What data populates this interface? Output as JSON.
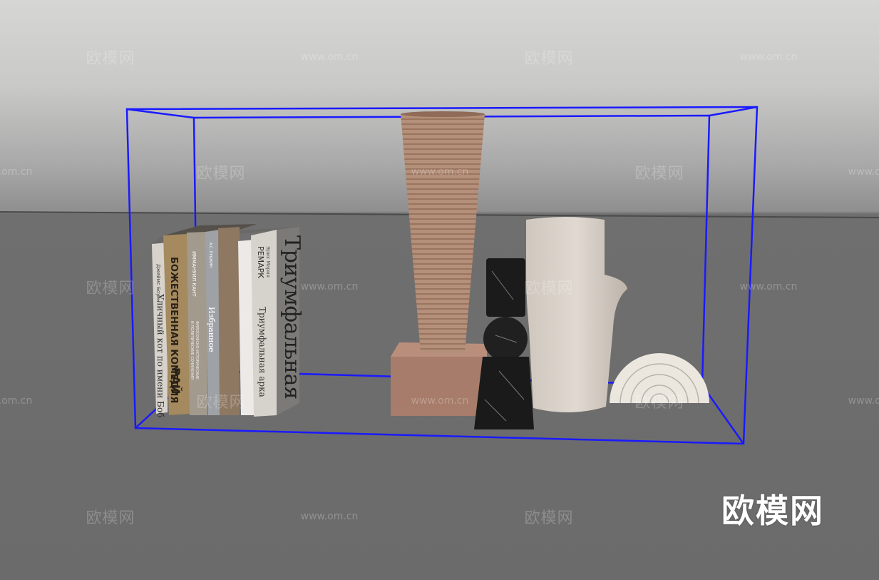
{
  "watermark": {
    "text": "欧模网",
    "url": "www.om.cn"
  },
  "logo": "欧模网",
  "books": {
    "b1_author": "Джеймс Боуэн",
    "b1_title": "Уличный кот по имени Боб",
    "b2_title": "БОЖЕСТВЕННАЯ КОМЕДИЯ",
    "b2_sub": "РАЙ",
    "b3_author": "ИММАНУИЛ КАНТ",
    "b3_title1": "ФИЛОСОФСКО-ИСТОРИЧЕСКИЕ",
    "b3_title2": "И ПОЛИТИЧЕСКИЕ СОЧИНЕНИЯ",
    "b4_author": "А.С. ПУШКИН",
    "b4_title": "Избранное",
    "b7_author1": "Эрих Мария",
    "b7_author2": "РЕМАРК",
    "b7_title": "Триумфальная арка",
    "cover_title": "Триумфальная"
  },
  "colors": {
    "bounding_box": "#1a1aff",
    "vase_terracotta": "#b08a74",
    "marble": "#1b1b1b",
    "white_vase": "#d8d1c9"
  }
}
